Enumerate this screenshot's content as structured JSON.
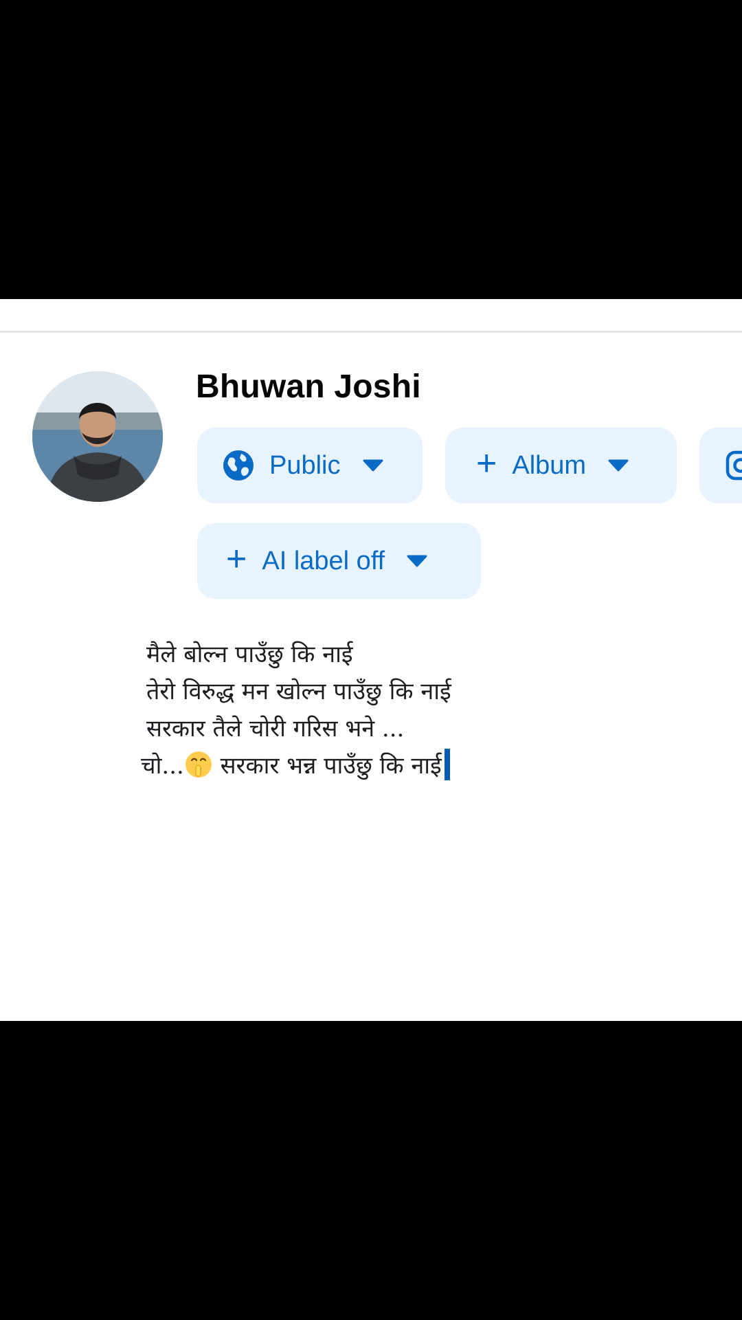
{
  "composer": {
    "user_name": "Bhuwan Joshi",
    "avatar": "profile-photo",
    "audience": {
      "label": "Public",
      "icon": "globe-icon",
      "dropdown_icon": "caret-down-icon"
    },
    "album": {
      "label": "Album",
      "icon": "plus-icon",
      "dropdown_icon": "caret-down-icon"
    },
    "instagram": {
      "icon": "instagram-icon"
    },
    "ai_label": {
      "label": "AI label off",
      "icon": "plus-icon",
      "dropdown_icon": "caret-down-icon"
    }
  },
  "post": {
    "lines": [
      "मैले बोल्न पाउँछु कि नाई",
      "तेरो विरुद्ध मन खोल्न पाउँछु कि नाई",
      "सरकार तैले चोरी गरिस भने ...",
      "चो..."
    ],
    "line4_after_emoji": " सरकार भन्न पाउँछु कि नाई",
    "emoji": "shushing-face-emoji"
  },
  "colors": {
    "accent": "#0a6bc7",
    "chip_background": "#e7f3ff",
    "text": "#1c1e21",
    "background": "#ffffff"
  }
}
